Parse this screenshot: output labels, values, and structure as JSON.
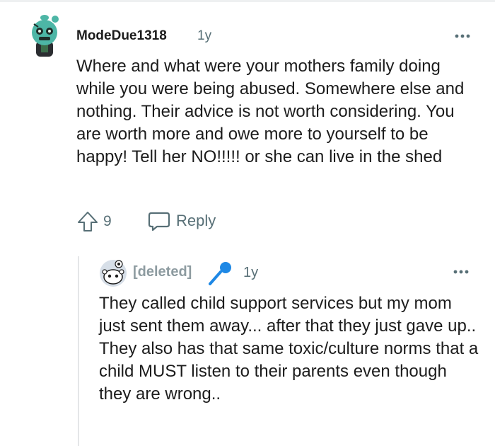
{
  "comment": {
    "author": "ModeDue1318",
    "age": "1y",
    "avatar_icon": "snoo-zombie-avatar-icon",
    "body": "Where and what were your mothers family doing while you were being abused. Somewhere else and nothing. Their advice is not worth considering. You are worth more and owe more to yourself to be happy! Tell her NO!!!!! or she can live in the shed",
    "score": "9",
    "reply_label": "Reply"
  },
  "reply": {
    "author": "[deleted]",
    "age": "1y",
    "avatar_icon": "default-snoo-avatar-icon",
    "badge_icon": "microphone-icon",
    "body": "They called child support services but my mom just sent them away... after that they just gave up.. They also has that same toxic/culture norms that a child MUST listen to their parents even though they are wrong.."
  },
  "colors": {
    "meta_text": "#576f76",
    "deleted_text": "#8d9ba0",
    "mic_blue": "#1e88e5",
    "thread_line": "#e4e6e8"
  }
}
